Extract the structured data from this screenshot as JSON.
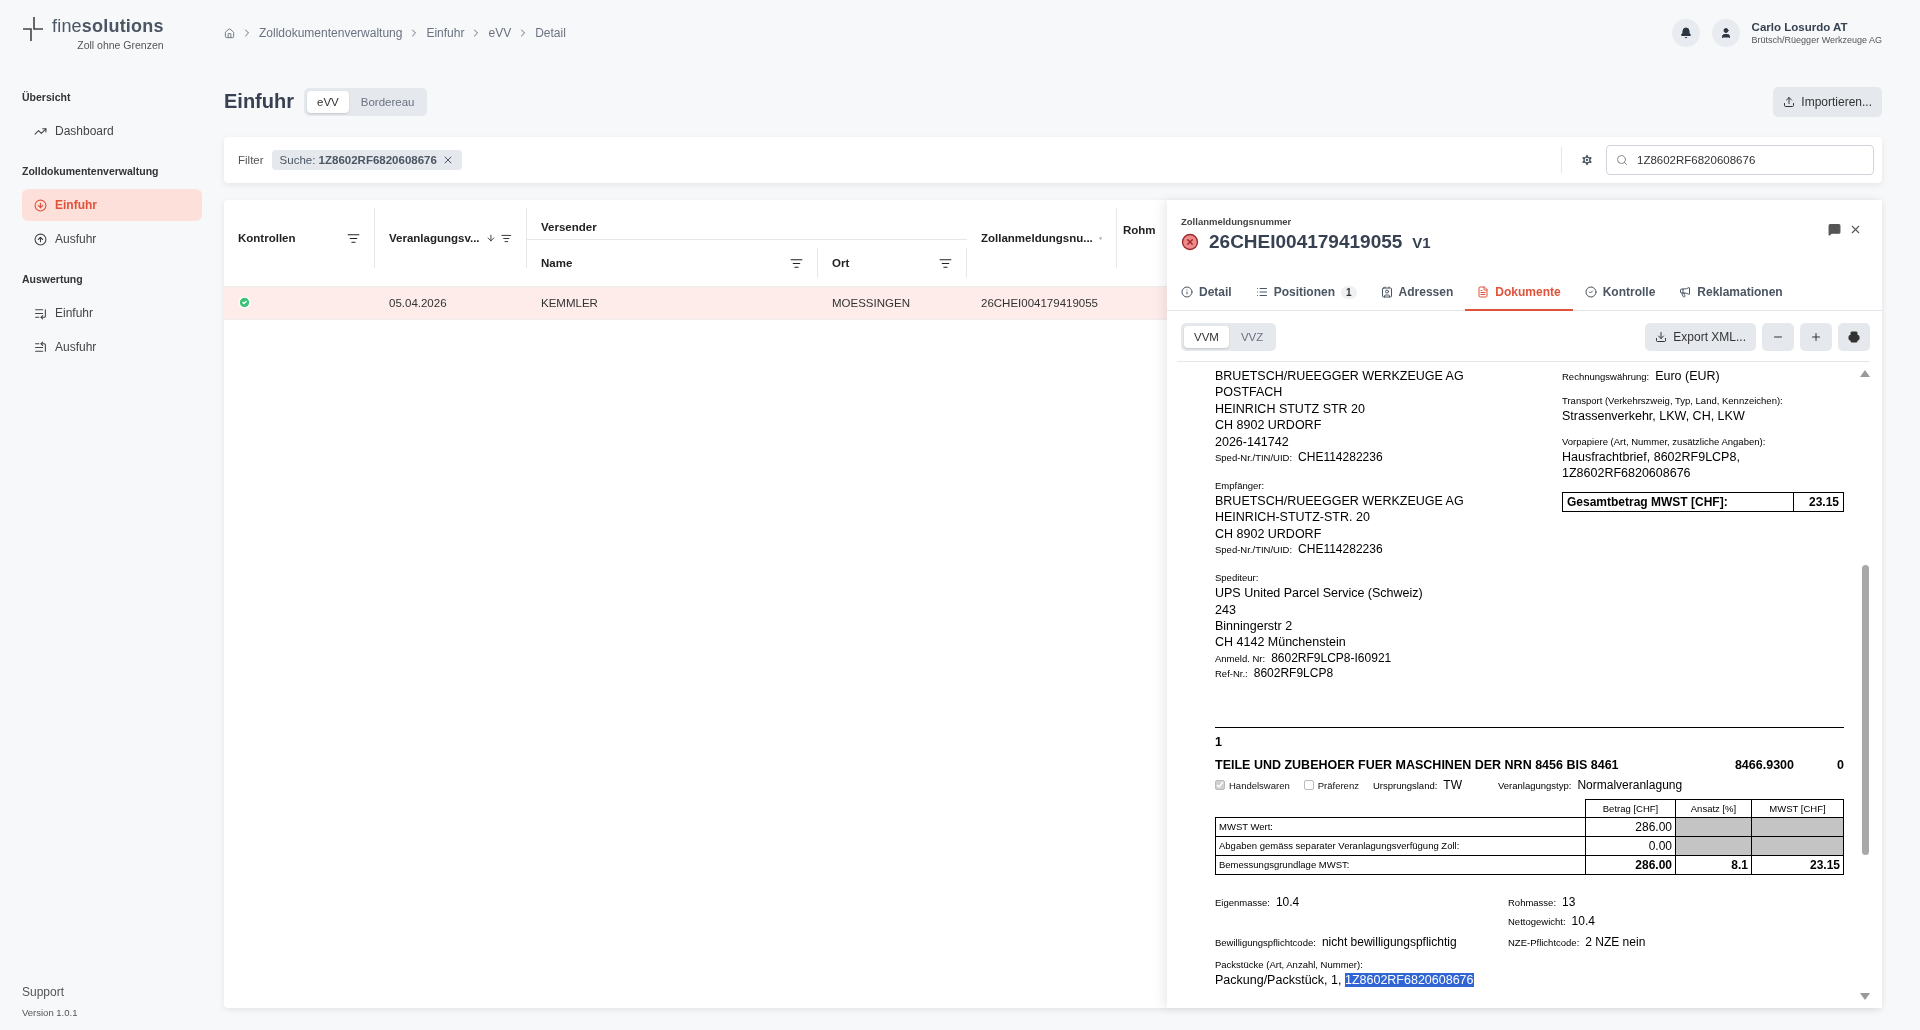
{
  "brand": {
    "name_light": "fine",
    "name_bold": "solutions",
    "tagline": "Zoll ohne Grenzen"
  },
  "sidebar": {
    "sections": [
      {
        "title": "Übersicht",
        "items": [
          {
            "label": "Dashboard",
            "selected": false
          }
        ]
      },
      {
        "title": "Zolldokumentenverwaltung",
        "items": [
          {
            "label": "Einfuhr",
            "selected": true
          },
          {
            "label": "Ausfuhr",
            "selected": false
          }
        ]
      },
      {
        "title": "Auswertung",
        "items": [
          {
            "label": "Einfuhr",
            "selected": false
          },
          {
            "label": "Ausfuhr",
            "selected": false
          }
        ]
      }
    ],
    "support": "Support",
    "version": "Version 1.0.1"
  },
  "breadcrumb": [
    "Zolldokumentenverwaltung",
    "Einfuhr",
    "eVV",
    "Detail"
  ],
  "user": {
    "name": "Carlo Losurdo AT",
    "company": "Brütsch/Rüegger Werkzeuge AG"
  },
  "page": {
    "title": "Einfuhr",
    "tabs": [
      {
        "label": "eVV",
        "selected": true
      },
      {
        "label": "Bordereau",
        "selected": false
      }
    ],
    "import_button": "Importieren..."
  },
  "filter": {
    "label": "Filter",
    "chip_label": "Suche:",
    "chip_value": "1Z8602RF6820608676",
    "search_value": "1Z8602RF6820608676"
  },
  "table": {
    "columns": [
      "Kontrollen",
      "Veranlagungsv...",
      "Name",
      "Ort",
      "Zollanmeldungsnu...",
      "Rohm"
    ],
    "group": "Versender",
    "rows": [
      {
        "date": "05.04.2026",
        "name": "KEMMLER",
        "place": "MOESSINGEN",
        "number": "26CHEI004179419055",
        "selected": true
      }
    ]
  },
  "detail": {
    "label": "Zollanmeldungsnummer",
    "number": "26CHEI004179419055",
    "version": "V1",
    "tabs": [
      {
        "label": "Detail",
        "selected": false
      },
      {
        "label": "Positionen",
        "badge": "1",
        "selected": false
      },
      {
        "label": "Adressen",
        "selected": false
      },
      {
        "label": "Dokumente",
        "selected": true
      },
      {
        "label": "Kontrolle",
        "selected": false
      },
      {
        "label": "Reklamationen",
        "selected": false
      }
    ],
    "doc_tabs": [
      {
        "label": "VVM",
        "selected": true
      },
      {
        "label": "VVZ",
        "selected": false
      }
    ],
    "export_button": "Export XML...",
    "document": {
      "left": [
        {
          "lines": [
            "BRUETSCH/RUEEGGER WERKZEUGE AG",
            "POSTFACH",
            "HEINRICH STUTZ STR 20",
            "CH 8902 URDORF",
            "2026-141742"
          ],
          "fields": [
            {
              "label": "Sped-Nr./TIN/UID:",
              "value": "CHE114282236"
            }
          ]
        },
        {
          "heading": "Empfänger:",
          "lines": [
            "BRUETSCH/RUEEGGER WERKZEUGE AG",
            "HEINRICH-STUTZ-STR. 20",
            "CH 8902 URDORF"
          ],
          "fields": [
            {
              "label": "Sped-Nr./TIN/UID:",
              "value": "CHE114282236"
            }
          ]
        },
        {
          "heading": "Spediteur:",
          "lines": [
            "UPS United Parcel Service (Schweiz)",
            "243",
            "Binningerstr 2",
            "CH 4142 Münchenstein"
          ],
          "fields": [
            {
              "label": "Anmeld. Nr:",
              "value": "8602RF9LCP8-I60921"
            },
            {
              "label": "Ref-Nr.:",
              "value": "8602RF9LCP8"
            }
          ]
        }
      ],
      "right": [
        {
          "kind": "inline",
          "label": "Rechnungswährung:",
          "lines": [
            "Euro (EUR)"
          ]
        },
        {
          "kind": "stacked",
          "label": "Transport (Verkehrszweig, Typ, Land, Kennzeichen):",
          "lines": [
            "Strassenverkehr, LKW, CH, LKW"
          ]
        },
        {
          "kind": "stacked",
          "label": "Vorpapiere (Art, Nummer, zusätzliche Angaben):",
          "lines": [
            "Hausfrachtbrief, 8602RF9LCP8,",
            "1Z8602RF6820608676"
          ]
        }
      ],
      "total": {
        "label": "Gesamtbetrag MWST [CHF]:",
        "value": "23.15"
      },
      "position": {
        "number": "1",
        "description": "TEILE UND ZUBEHOER FUER MASCHINEN DER NRN 8456 BIS 8461",
        "tariff": "8466.9300",
        "code": "0",
        "checks": [
          {
            "label": "Handelswaren",
            "checked": true
          },
          {
            "label": "Präferenz",
            "checked": false
          }
        ],
        "origin": {
          "label": "Ursprungsland:",
          "value": "TW"
        },
        "type": {
          "label": "Veranlagungstyp:",
          "value": "Normalveranlagung"
        },
        "tax_columns": [
          "Betrag [CHF]",
          "Ansatz [%]",
          "MWST [CHF]"
        ],
        "tax_rows": [
          {
            "label": "MWST Wert:",
            "cells": [
              "286.00",
              null,
              null
            ],
            "bold": false
          },
          {
            "label": "Abgaben gemäss separater Veranlagungsverfügung Zoll:",
            "cells": [
              "0.00",
              null,
              null
            ],
            "bold": false
          },
          {
            "label": "Bemessungsgrundlage MWST:",
            "cells": [
              "286.00",
              "8.1",
              "23.15"
            ],
            "bold": true
          }
        ],
        "masses": [
          [
            {
              "label": "Eigenmasse:",
              "value": "10.4"
            }
          ],
          [
            {
              "label": "Rohmasse:",
              "value": "13"
            },
            {
              "label": "Nettogewicht:",
              "value": "10.4"
            }
          ]
        ],
        "codes": [
          {
            "label": "Bewilligungspflichtcode:",
            "value": "nicht bewilligungspflichtig"
          },
          {
            "label": "NZE-Pflichtcode:",
            "value": "2 NZE nein"
          }
        ],
        "packages": {
          "label": "Packstücke (Art, Anzahl, Nummer):",
          "text": "Packung/Packstück, 1, ",
          "highlight": "1Z8602RF6820608676"
        }
      }
    }
  }
}
